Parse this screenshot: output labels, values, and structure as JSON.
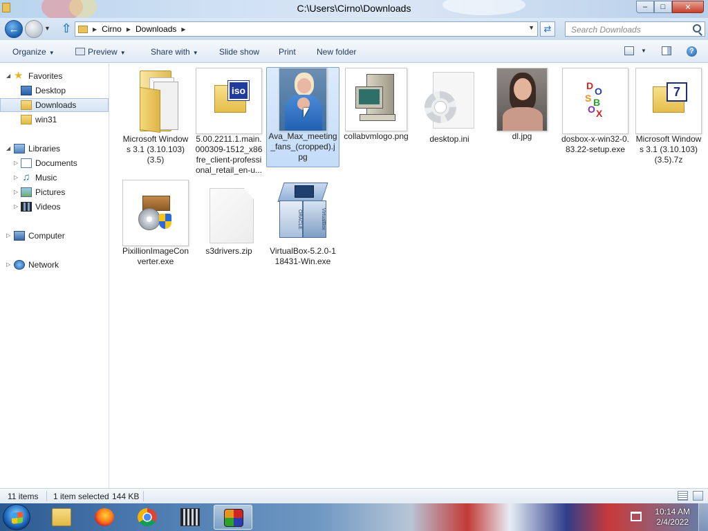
{
  "window": {
    "title": "C:\\Users\\Cirno\\Downloads",
    "minimize_glyph": "–",
    "maximize_glyph": "□",
    "close_glyph": "✕"
  },
  "navbar": {
    "breadcrumbs": [
      "Cirno",
      "Downloads"
    ],
    "search_placeholder": "Search Downloads"
  },
  "toolbar": {
    "organize": "Organize",
    "preview": "Preview",
    "share_with": "Share with",
    "slide_show": "Slide show",
    "print": "Print",
    "new_folder": "New folder"
  },
  "sidebar": {
    "favorites": {
      "label": "Favorites",
      "items": [
        "Desktop",
        "Downloads",
        "win31"
      ]
    },
    "libraries": {
      "label": "Libraries",
      "items": [
        "Documents",
        "Music",
        "Pictures",
        "Videos"
      ]
    },
    "computer": "Computer",
    "network": "Network",
    "selected": "Downloads"
  },
  "files": [
    {
      "name": "Microsoft Windows 3.1 (3.10.103) (3.5)",
      "icon": "folder-icon"
    },
    {
      "name": "5.00.2211.1.main.000309-1512_x86fre_client-professional_retail_en-u...",
      "icon": "iso-file-icon"
    },
    {
      "name": "Ava_Max_meeting_fans_(cropped).jpg",
      "icon": "photo-thumbnail",
      "selected": true
    },
    {
      "name": "collabvmlogo.png",
      "icon": "computer-logo-thumbnail"
    },
    {
      "name": "desktop.ini",
      "icon": "settings-file-icon"
    },
    {
      "name": "dl.jpg",
      "icon": "photo-thumbnail"
    },
    {
      "name": "dosbox-x-win32-0.83.22-setup.exe",
      "icon": "dosbox-icon"
    },
    {
      "name": "Microsoft Windows 3.1 (3.10.103) (3.5).7z",
      "icon": "7z-archive-icon"
    },
    {
      "name": "PixillionImageConverter.exe",
      "icon": "installer-icon"
    },
    {
      "name": "s3drivers.zip",
      "icon": "zip-file-icon"
    },
    {
      "name": "VirtualBox-5.2.0-118431-Win.exe",
      "icon": "virtualbox-icon"
    }
  ],
  "virtualbox_box_text": [
    "ORACLE",
    "VirtualBox"
  ],
  "iso_label": "iso",
  "sevenzip_label": "7",
  "dosbox_letters": [
    "D",
    "O",
    "S",
    "B",
    "O",
    "X"
  ],
  "status": {
    "item_count": "11 items",
    "selection": "1 item selected",
    "size": "144 KB"
  },
  "taskbar": {
    "apps": [
      "file-explorer-icon",
      "firefox-icon",
      "chrome-icon",
      "putty-icon",
      "dosbox-icon"
    ],
    "active_app": "dosbox-icon",
    "time": "10:14 AM",
    "date": "2/4/2022"
  }
}
